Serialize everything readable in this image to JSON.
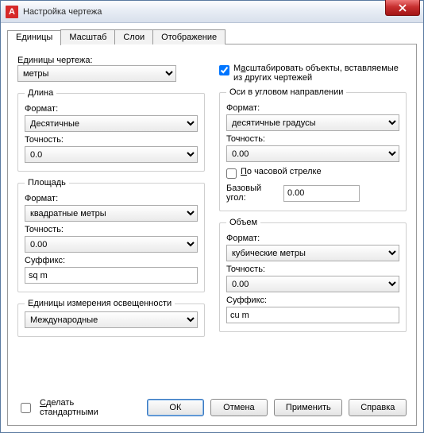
{
  "window": {
    "title": "Настройка чертежа",
    "app_icon_letter": "A"
  },
  "tabs": {
    "units": "Единицы",
    "scale": "Масштаб",
    "layers": "Слои",
    "display": "Отображение"
  },
  "drawing_units": {
    "label": "Единицы чертежа:",
    "value": "метры"
  },
  "length": {
    "legend": "Длина",
    "format_label": "Формат:",
    "format_value": "Десятичные",
    "precision_label": "Точность:",
    "precision_value": "0.0"
  },
  "area": {
    "legend": "Площадь",
    "format_label": "Формат:",
    "format_value": "квадратные метры",
    "precision_label": "Точность:",
    "precision_value": "0.00",
    "suffix_label": "Суффикс:",
    "suffix_value": "sq m"
  },
  "lighting": {
    "legend": "Единицы измерения освещенности",
    "value": "Международные"
  },
  "scale_objects": {
    "label_prefix": "М",
    "label_under": "а",
    "label_rest": "сштабировать объекты, вставляемые из других чертежей"
  },
  "axis": {
    "legend": "Оси в угловом направлении",
    "format_label": "Формат:",
    "format_value": "десятичные градусы",
    "precision_label": "Точность:",
    "precision_value": "0.00",
    "clockwise_under": "П",
    "clockwise_rest": "о часовой стрелке",
    "base_angle_label": "Базовый угол:",
    "base_angle_value": "0.00"
  },
  "volume": {
    "legend": "Объем",
    "format_label": "Формат:",
    "format_value": "кубические метры",
    "precision_label": "Точность:",
    "precision_value": "0.00",
    "suffix_label": "Суффикс:",
    "suffix_value": "cu m"
  },
  "footer": {
    "make_default_under": "С",
    "make_default_rest": "делать стандартными",
    "ok": "ОК",
    "cancel": "Отмена",
    "apply": "Применить",
    "help": "Справка"
  }
}
